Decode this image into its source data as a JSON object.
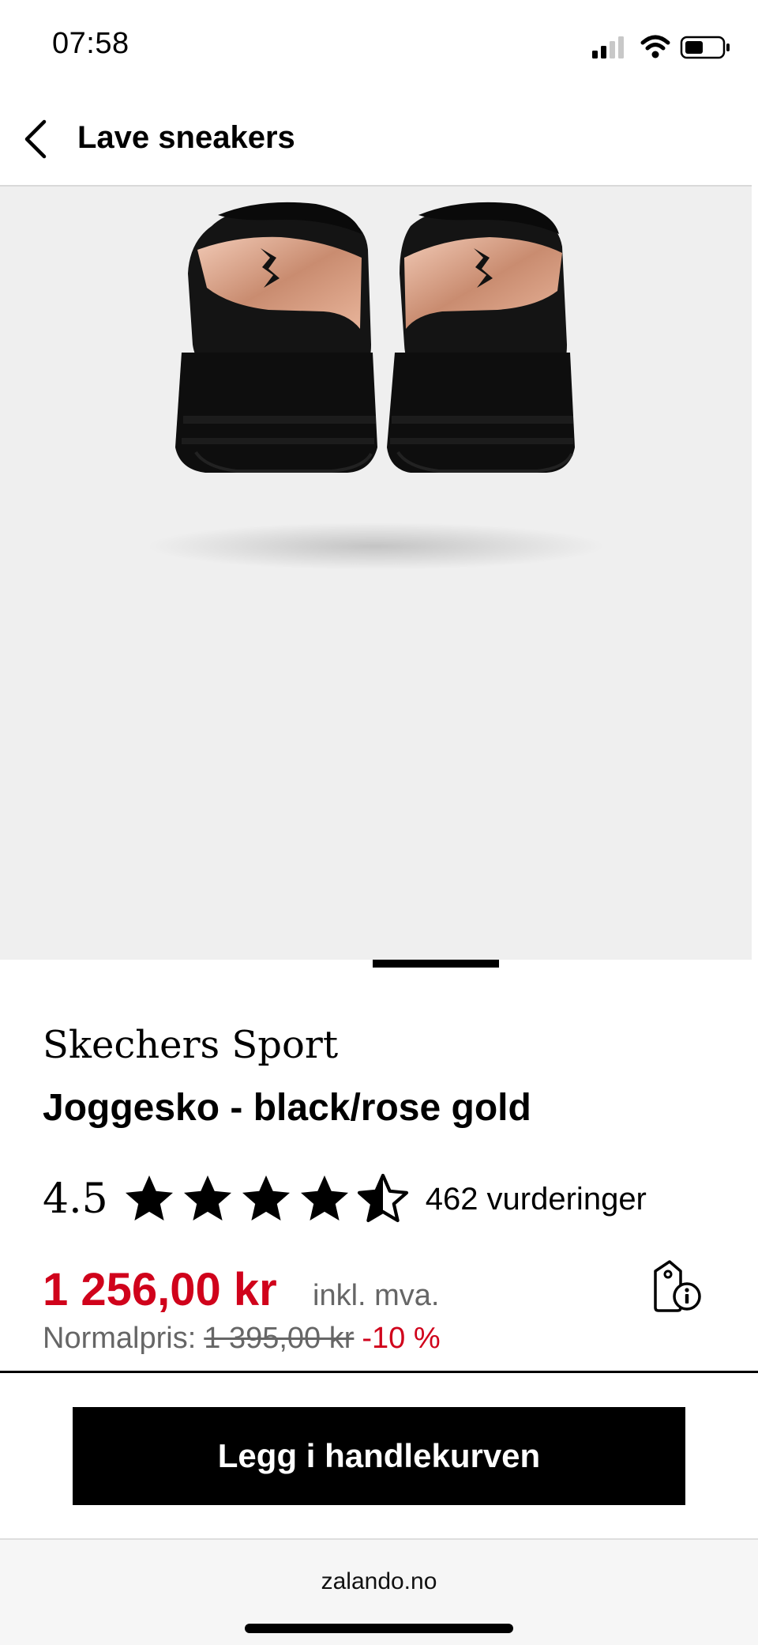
{
  "status_bar": {
    "time": "07:58",
    "icons": [
      "signal-icon",
      "wifi-icon",
      "battery-icon"
    ]
  },
  "header": {
    "back_icon": "chevron-left-icon",
    "title": "Lave sneakers"
  },
  "gallery": {
    "image": "black-sneakers-back-view-image",
    "current_index": 1
  },
  "product": {
    "brand": "Skechers Sport",
    "name": "Joggesko - black/rose gold",
    "rating": "4.5",
    "rating_value": 4.5,
    "rating_max": 5,
    "review_count": "462 vurderinger",
    "price": "1 256,00 kr",
    "vat_label": "inkl. mva.",
    "normal_price_label": "Normalpris:",
    "normal_price": "1 395,00 kr",
    "discount": "-10 %",
    "info_icon": "price-info-tag-icon"
  },
  "actions": {
    "add_to_cart": "Legg i handlekurven"
  },
  "browser": {
    "url": "zalando.no"
  },
  "colors": {
    "sale_red": "#d0021b",
    "gallery_bg": "#efefef",
    "rose_gold": "#d9a48a"
  }
}
